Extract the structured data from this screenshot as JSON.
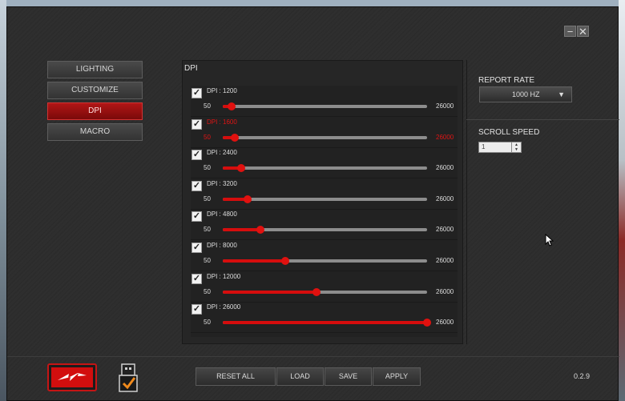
{
  "window": {
    "minimize_glyph": "−",
    "close_glyph": "✕"
  },
  "nav": [
    {
      "label": "LIGHTING",
      "active": false
    },
    {
      "label": "CUSTOMIZE",
      "active": false
    },
    {
      "label": "DPI",
      "active": true
    },
    {
      "label": "MACRO",
      "active": false
    }
  ],
  "dpi": {
    "title": "DPI",
    "min": 50,
    "max": 26000,
    "rows": [
      {
        "label": "DPI : 1200",
        "min_label": "50",
        "max_label": "26000",
        "value": 1200,
        "checked": true,
        "selected": false
      },
      {
        "label": "DPI : 1600",
        "min_label": "50",
        "max_label": "26000",
        "value": 1600,
        "checked": true,
        "selected": true
      },
      {
        "label": "DPI : 2400",
        "min_label": "50",
        "max_label": "26000",
        "value": 2400,
        "checked": true,
        "selected": false
      },
      {
        "label": "DPI : 3200",
        "min_label": "50",
        "max_label": "26000",
        "value": 3200,
        "checked": true,
        "selected": false
      },
      {
        "label": "DPI : 4800",
        "min_label": "50",
        "max_label": "26000",
        "value": 4800,
        "checked": true,
        "selected": false
      },
      {
        "label": "DPI : 8000",
        "min_label": "50",
        "max_label": "26000",
        "value": 8000,
        "checked": true,
        "selected": false
      },
      {
        "label": "DPI : 12000",
        "min_label": "50",
        "max_label": "26000",
        "value": 12000,
        "checked": true,
        "selected": false
      },
      {
        "label": "DPI : 26000",
        "min_label": "50",
        "max_label": "26000",
        "value": 26000,
        "checked": true,
        "selected": false
      }
    ]
  },
  "report_rate": {
    "label": "REPORT RATE",
    "value": "1000 HZ",
    "arrow": "▼"
  },
  "scroll_speed": {
    "label": "SCROLL SPEED",
    "value": "1",
    "up": "▲",
    "down": "▼"
  },
  "footer": {
    "buttons": {
      "reset_all": "RESET ALL",
      "load": "LOAD",
      "save": "SAVE",
      "apply": "APPLY"
    },
    "version": "0.2.9"
  },
  "colors": {
    "accent": "#d60d0d",
    "panel": "#262626"
  },
  "icons": {
    "logo": "lightning-logo-icon",
    "usb": "usb-connected-icon",
    "cursor": "mouse-pointer-icon"
  }
}
